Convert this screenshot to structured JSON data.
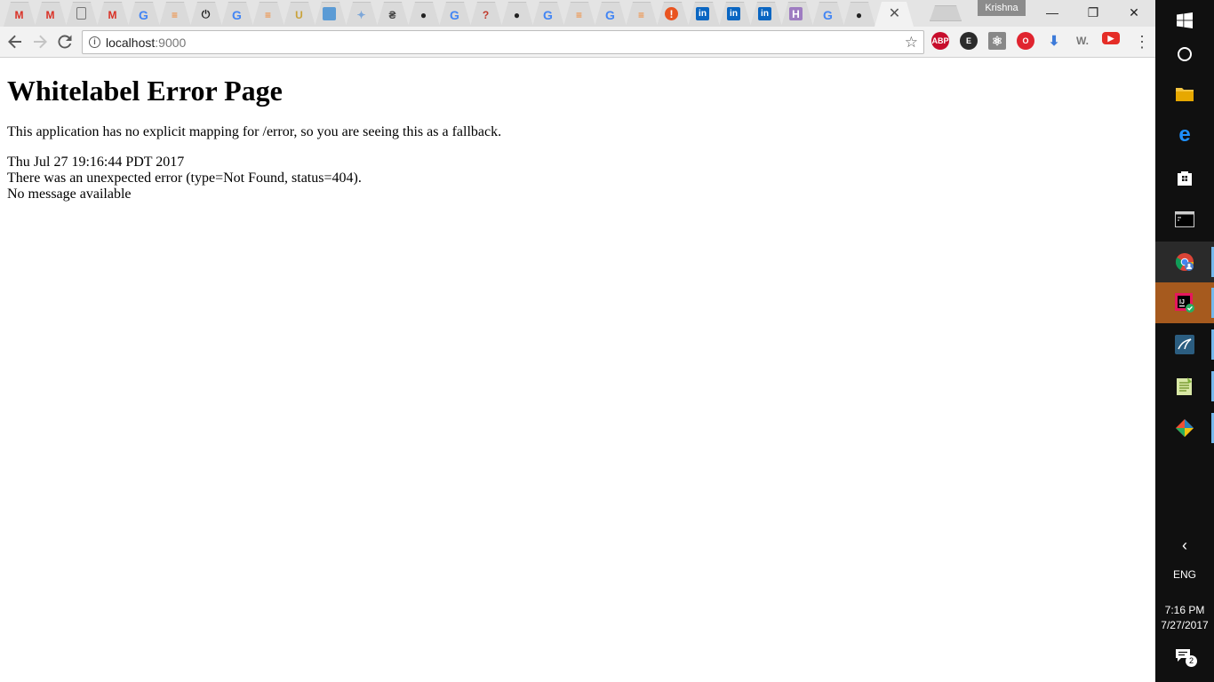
{
  "browser": {
    "tabs": [
      {
        "icon": "gmail-icon",
        "glyph": "M",
        "color": "#d93025"
      },
      {
        "icon": "gmail-icon",
        "glyph": "M",
        "color": "#d93025"
      },
      {
        "icon": "document-icon",
        "glyph": "",
        "color": "#777777"
      },
      {
        "icon": "gmail-icon",
        "glyph": "M",
        "color": "#d93025"
      },
      {
        "icon": "google-icon",
        "glyph": "G",
        "color": "#4285f4"
      },
      {
        "icon": "stackoverflow-icon",
        "glyph": "≡",
        "color": "#f48024"
      },
      {
        "icon": "power-icon",
        "glyph": "⏻",
        "color": "#222222"
      },
      {
        "icon": "google-icon",
        "glyph": "G",
        "color": "#4285f4"
      },
      {
        "icon": "stackoverflow-icon",
        "glyph": "≡",
        "color": "#f48024"
      },
      {
        "icon": "magnet-icon",
        "glyph": "U",
        "color": "#c9a23a"
      },
      {
        "icon": "blue-square-icon",
        "glyph": "",
        "color": "#5b9bd5"
      },
      {
        "icon": "puzzle-icon",
        "glyph": "✦",
        "color": "#7da7d9"
      },
      {
        "icon": "app-icon",
        "glyph": "₴",
        "color": "#444444"
      },
      {
        "icon": "github-icon",
        "glyph": "●",
        "color": "#222222"
      },
      {
        "icon": "google-icon",
        "glyph": "G",
        "color": "#4285f4"
      },
      {
        "icon": "question-icon",
        "glyph": "?",
        "color": "#c0392b"
      },
      {
        "icon": "github-icon",
        "glyph": "●",
        "color": "#222222"
      },
      {
        "icon": "google-icon",
        "glyph": "G",
        "color": "#4285f4"
      },
      {
        "icon": "stackoverflow-icon",
        "glyph": "≡",
        "color": "#f48024"
      },
      {
        "icon": "google-icon",
        "glyph": "G",
        "color": "#4285f4"
      },
      {
        "icon": "stackoverflow-icon",
        "glyph": "≡",
        "color": "#f48024"
      },
      {
        "icon": "alert-icon",
        "glyph": "!",
        "color": "#e95420"
      },
      {
        "icon": "linkedin-icon",
        "glyph": "in",
        "color": "#0a66c2"
      },
      {
        "icon": "linkedin-icon",
        "glyph": "in",
        "color": "#0a66c2"
      },
      {
        "icon": "linkedin-icon",
        "glyph": "in",
        "color": "#0a66c2"
      },
      {
        "icon": "heroku-icon",
        "glyph": "H",
        "color": "#9e7cc1"
      },
      {
        "icon": "google-icon",
        "glyph": "G",
        "color": "#4285f4"
      },
      {
        "icon": "github-icon",
        "glyph": "●",
        "color": "#222222"
      }
    ],
    "active_tab_close": "✕",
    "profile_name": "Krishna",
    "window_controls": {
      "minimize": "—",
      "maximize": "❐",
      "close": "✕"
    },
    "address_bar": {
      "host": "localhost",
      "port": ":9000"
    },
    "extensions": [
      {
        "icon": "adblock-plus-icon",
        "glyph": "ABP",
        "color": "#c70d2c"
      },
      {
        "icon": "evernote-icon",
        "glyph": "E",
        "color": "#2b2b2b"
      },
      {
        "icon": "react-devtools-icon",
        "glyph": "⚛",
        "color": "#888888"
      },
      {
        "icon": "opera-icon",
        "glyph": "O",
        "color": "#e0242f"
      },
      {
        "icon": "download-icon",
        "glyph": "⬇",
        "color": "#3d7bd9"
      },
      {
        "icon": "wappalyzer-icon",
        "glyph": "W.",
        "color": "#777777"
      },
      {
        "icon": "youtube-icon",
        "glyph": "▶",
        "color": "#e52d27"
      }
    ]
  },
  "page": {
    "title": "Whitelabel Error Page",
    "message": "This application has no explicit mapping for /error, so you are seeing this as a fallback.",
    "timestamp": "Thu Jul 27 19:16:44 PDT 2017",
    "error_line": "There was an unexpected error (type=Not Found, status=404).",
    "detail": "No message available"
  },
  "taskbar": {
    "language": "ENG",
    "time": "7:16 PM",
    "date": "7/27/2017",
    "notification_count": "2"
  }
}
